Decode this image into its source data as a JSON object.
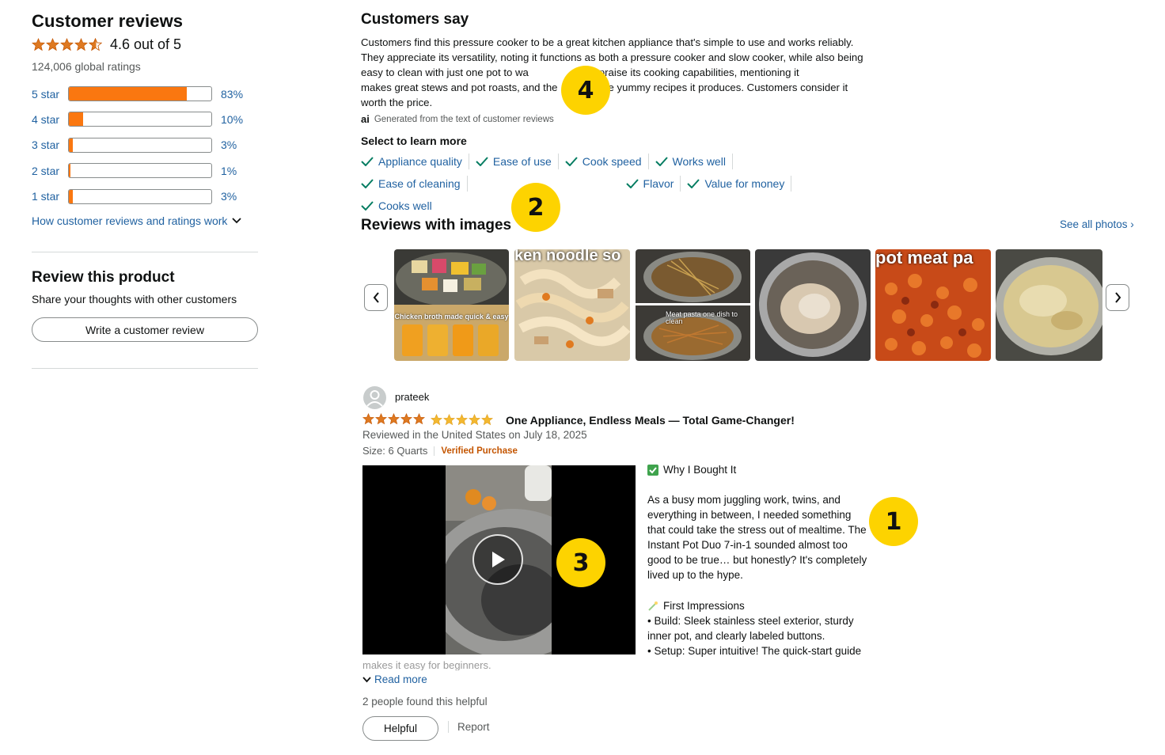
{
  "customer_reviews": {
    "title": "Customer reviews",
    "average_rating": 4.6,
    "average_text": "4.6 out of 5",
    "global_ratings": "124,006 global ratings",
    "histogram": [
      {
        "label": "5 star",
        "percent": 83,
        "percent_text": "83%"
      },
      {
        "label": "4 star",
        "percent": 10,
        "percent_text": "10%"
      },
      {
        "label": "3 star",
        "percent": 3,
        "percent_text": "3%"
      },
      {
        "label": "2 star",
        "percent": 1,
        "percent_text": "1%"
      },
      {
        "label": "1 star",
        "percent": 3,
        "percent_text": "3%"
      }
    ],
    "how_link": "How customer reviews and ratings work"
  },
  "review_product": {
    "title": "Review this product",
    "subtitle": "Share your thoughts with other customers",
    "button": "Write a customer review"
  },
  "customers_say": {
    "title": "Customers say",
    "summary": "Customers find this pressure cooker to be a great kitchen appliance that's simple to use and works reliably. They appreciate its versatility, noting it functions as both a pressure cooker and slow cooker, while also being easy to clean with just one pot to wa",
    "summary_cont1": "mers praise its cooking capabilities, mentioning it",
    "summary_line4a": "makes great stews and pot roasts, and the",
    "summary_line4b": "e yummy recipes it produces. Customers consider it",
    "summary_line5": "worth the price.",
    "ai_icon": "ai",
    "ai_note": "Generated from the text of customer reviews",
    "select_title": "Select to learn more",
    "chips": [
      "Appliance quality",
      "Ease of use",
      "Cook speed",
      "Works well",
      "Ease of cleaning",
      "Flavor",
      "Value for money",
      "Cooks well"
    ]
  },
  "reviews_with_images": {
    "title": "Reviews with images",
    "see_all": "See all photos ›",
    "thumb_captions": [
      "Chicken broth made quick & easy",
      "ken noodle so",
      "Meat pasta one dish to clean",
      "pot meat pa"
    ]
  },
  "review": {
    "reviewer": "prateek",
    "rating": 5,
    "title": "One Appliance, Endless Meals — Total Game-Changer!",
    "meta": "Reviewed in the United States on July 18, 2025",
    "size": "Size: 6 Quarts",
    "verified": "Verified Purchase",
    "section1_title": "Why I Bought It",
    "paragraph1": [
      "As a busy mom juggling work, twins, and",
      "everything in between, I needed something",
      "that could take the stress out of mealtime. The",
      "Instant Pot Duo 7-in-1 sounded almost too",
      "good to be true… but honestly? It's completely",
      "lived up to the hype."
    ],
    "section2_title": "First Impressions",
    "paragraph2": [
      "• Build: Sleek stainless steel exterior, sturdy",
      "inner pot, and clearly labeled buttons.",
      "• Setup: Super intuitive! The quick-start guide"
    ],
    "faded": "makes it easy for beginners.",
    "read_more": "Read more",
    "helpful_count": "2 people found this helpful",
    "helpful_button": "Helpful",
    "report": "Report"
  },
  "badges": [
    "1",
    "2",
    "3",
    "4"
  ],
  "colors": {
    "accent_orange": "#fa7710",
    "link_blue": "#2162a1",
    "star_orange": "#f3a847",
    "badge_yellow": "#fdd300",
    "verified_orange": "#c45500",
    "check_teal": "#067d62"
  }
}
